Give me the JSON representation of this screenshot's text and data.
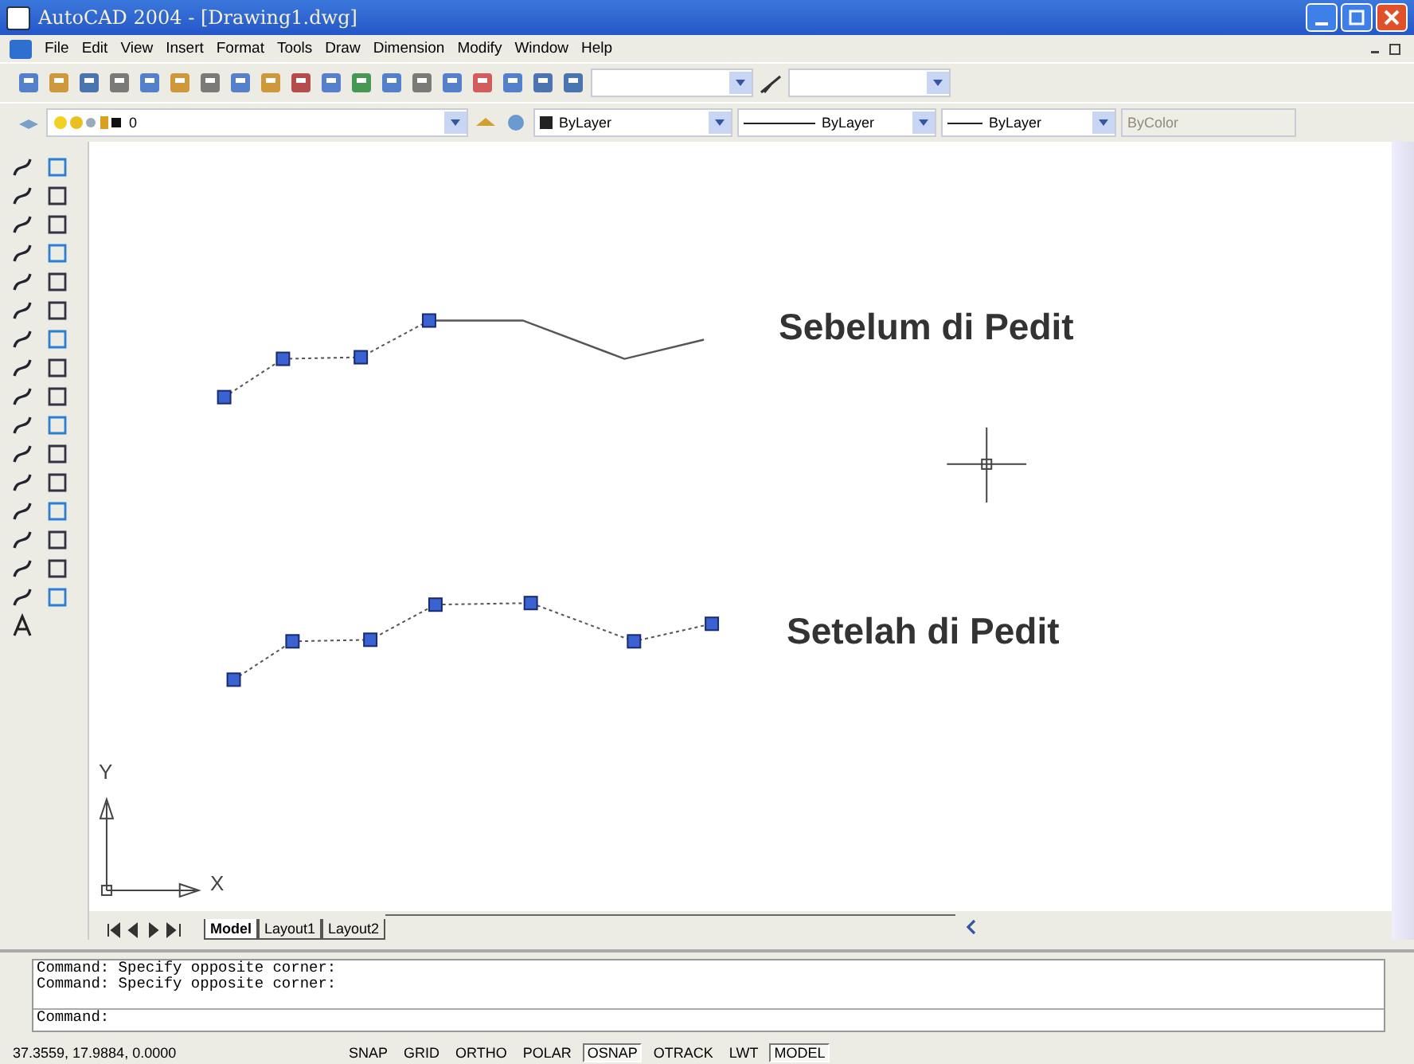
{
  "window": {
    "title": "AutoCAD 2004 - [Drawing1.dwg]"
  },
  "menu": [
    "File",
    "Edit",
    "View",
    "Insert",
    "Format",
    "Tools",
    "Draw",
    "Dimension",
    "Modify",
    "Window",
    "Help"
  ],
  "layers_toolbar": {
    "layer": "0"
  },
  "properties_toolbar": {
    "color_setting": "ByLayer",
    "linetype": "ByLayer",
    "lineweight": "ByLayer",
    "plot_style": "ByColor",
    "plot_style_disabled": true
  },
  "canvas": {
    "labels": [
      "Sebelum di Pedit",
      "Setelah di Pedit"
    ],
    "ucs_y": "Y",
    "ucs_x": "X"
  },
  "tabs": [
    {
      "label": "Model",
      "selected": true
    },
    {
      "label": "Layout1",
      "selected": false
    },
    {
      "label": "Layout2",
      "selected": false
    }
  ],
  "command_history": [
    "Command:  Specify opposite corner:",
    "Command:  Specify opposite corner:"
  ],
  "command_prompt": "Command:",
  "status_bar": {
    "coordinates": "37.3559, 17.9884, 0.0000",
    "toggles": [
      {
        "label": "SNAP",
        "on": false
      },
      {
        "label": "GRID",
        "on": false
      },
      {
        "label": "ORTHO",
        "on": false
      },
      {
        "label": "POLAR",
        "on": false
      },
      {
        "label": "OSNAP",
        "on": true
      },
      {
        "label": "OTRACK",
        "on": false
      },
      {
        "label": "LWT",
        "on": false
      },
      {
        "label": "MODEL",
        "on": true
      }
    ]
  }
}
